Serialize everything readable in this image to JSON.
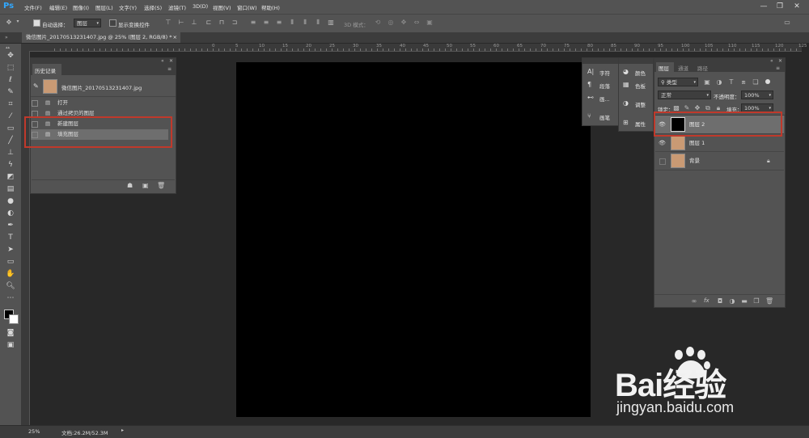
{
  "app": {
    "logo": "Ps"
  },
  "menu": [
    "文件(F)",
    "编辑(E)",
    "图像(I)",
    "图层(L)",
    "文字(Y)",
    "选择(S)",
    "滤镜(T)",
    "3D(D)",
    "视图(V)",
    "窗口(W)",
    "帮助(H)"
  ],
  "window_buttons": {
    "minimize": "—",
    "restore": "❐",
    "close": "✕"
  },
  "options": {
    "auto_select_label": "自动选择：",
    "auto_select_value": "图层",
    "show_transform_label": "显示变换控件",
    "three_d_mode_label": "3D 模式："
  },
  "document": {
    "tab_title": "微信图片_20170513231407.jpg @ 25% (图层 2, RGB/8) *",
    "close": "×"
  },
  "ruler_labels": [
    "0",
    "5",
    "10",
    "15",
    "20",
    "25",
    "30",
    "35",
    "40",
    "45",
    "50",
    "55",
    "60",
    "65",
    "70",
    "75",
    "80",
    "85",
    "90",
    "95",
    "100",
    "105",
    "110",
    "115",
    "120",
    "125",
    "130",
    "135",
    "140",
    "145",
    "150",
    "155",
    "160"
  ],
  "history": {
    "tab": "历史记录",
    "snapshot": "微信图片_20170513231407.jpg",
    "items": [
      {
        "label": "打开",
        "selected": false
      },
      {
        "label": "通过拷贝的图层",
        "selected": false
      },
      {
        "label": "新建图层",
        "selected": false
      },
      {
        "label": "填充图层",
        "selected": true
      }
    ]
  },
  "mini_panels": {
    "left": [
      "字符",
      "段落",
      "画...",
      "画笔"
    ],
    "right": [
      "颜色",
      "色板",
      "调整",
      "属性"
    ]
  },
  "layers": {
    "tabs": [
      "图层",
      "通道",
      "路径"
    ],
    "filter_kind": "类型",
    "blend_mode": "正常",
    "opacity_label": "不透明度：",
    "opacity_value": "100%",
    "lock_label": "锁定：",
    "fill_label": "填充：",
    "fill_value": "100%",
    "items": [
      {
        "name": "图层 2",
        "visible": true,
        "selected": true,
        "locked": false
      },
      {
        "name": "图层 1",
        "visible": true,
        "selected": false,
        "locked": false
      },
      {
        "name": "背景",
        "visible": false,
        "selected": false,
        "locked": true
      }
    ],
    "footer_icons": [
      "link-icon",
      "fx-icon",
      "mask-icon",
      "adjustment-icon",
      "folder-icon",
      "new-layer-icon",
      "trash-icon"
    ],
    "fx_label": "fx"
  },
  "status": {
    "zoom": "25%",
    "doc_info": "文档:26.2M/52.3M"
  },
  "watermark": {
    "main": "Bai经验",
    "url": "jingyan.baidu.com"
  },
  "colors": {
    "highlight": "#c0392b",
    "panel": "#535353",
    "canvas": "#000000"
  }
}
